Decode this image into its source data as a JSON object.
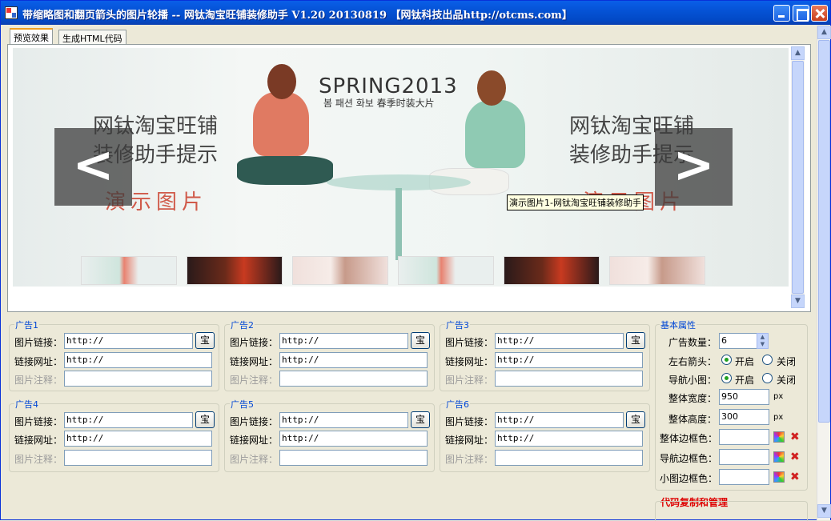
{
  "window": {
    "title": "带缩略图和翻页箭头的图片轮播 -- 网钛淘宝旺铺装修助手 V1.20 20130819 【网钛科技出品http://otcms.com】"
  },
  "tabs": [
    {
      "label": "预览效果",
      "active": true
    },
    {
      "label": "生成HTML代码",
      "active": false
    }
  ],
  "preview": {
    "left_text": [
      "网钛淘宝旺铺",
      "装修助手提示"
    ],
    "left_red": "演示图片",
    "right_text": [
      "网钛淘宝旺铺",
      "装修助手提示"
    ],
    "right_red": "演示图片",
    "spring_title": "SPRING2013",
    "spring_sub": "봄 패션 화보 春季时装大片",
    "prev_arrow": "<",
    "next_arrow": ">",
    "tooltip": "演示图片1-网钛淘宝旺铺装修助手",
    "thumb_count": 6
  },
  "labels": {
    "img_link": "图片链接：",
    "link_url": "链接网址：",
    "img_note": "图片注释：",
    "bao_button": "宝"
  },
  "ads": [
    {
      "title": "广告1",
      "img_link": "http://",
      "link_url": "http://",
      "img_note": ""
    },
    {
      "title": "广告2",
      "img_link": "http://",
      "link_url": "http://",
      "img_note": ""
    },
    {
      "title": "广告3",
      "img_link": "http://",
      "link_url": "http://",
      "img_note": ""
    },
    {
      "title": "广告4",
      "img_link": "http://",
      "link_url": "http://",
      "img_note": ""
    },
    {
      "title": "广告5",
      "img_link": "http://",
      "link_url": "http://",
      "img_note": ""
    },
    {
      "title": "广告6",
      "img_link": "http://",
      "link_url": "http://",
      "img_note": ""
    }
  ],
  "props": {
    "title": "基本属性",
    "ad_count_label": "广告数量：",
    "ad_count": "6",
    "arrows_label": "左右箭头：",
    "thumbs_label": "导航小图：",
    "on_label": "开启",
    "off_label": "关闭",
    "arrows_on": true,
    "thumbs_on": true,
    "width_label": "整体宽度：",
    "width_value": "950",
    "height_label": "整体高度：",
    "height_value": "300",
    "px": "px",
    "border_color_label": "整体边框色：",
    "nav_border_label": "导航边框色：",
    "thumb_border_label": "小图边框色："
  },
  "code_section": {
    "title": "代码复制和管理"
  }
}
